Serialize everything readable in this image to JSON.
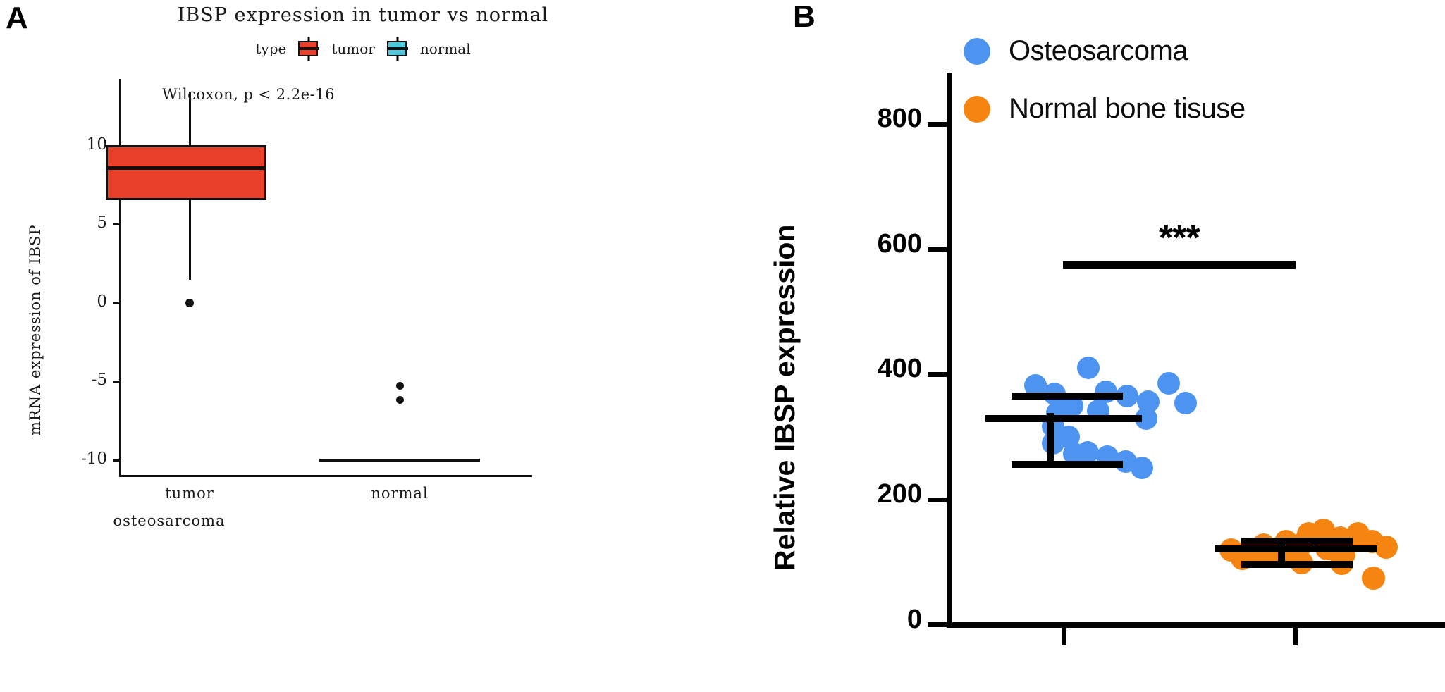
{
  "figure": {
    "panels": [
      {
        "letter": "A"
      },
      {
        "letter": "B"
      }
    ]
  },
  "panel_a": {
    "letter": "A",
    "title": "IBSP expression in tumor vs normal",
    "legend_title": "type",
    "legend_items": [
      {
        "label": "tumor",
        "color": "#E8402A"
      },
      {
        "label": "normal",
        "color": "#4DC8DD"
      }
    ],
    "annotation": "Wilcoxon, p < 2.2e-16",
    "y_axis_title": "mRNA expression of IBSP",
    "x_axis_title": "osteosarcoma",
    "y_ticks": [
      "10",
      "5",
      "0",
      "-5",
      "-10"
    ],
    "x_categories": [
      "tumor",
      "normal"
    ]
  },
  "panel_b": {
    "letter": "B",
    "y_axis_title": "Relative IBSP expression",
    "y_ticks": [
      "800",
      "600",
      "400",
      "200",
      "0"
    ],
    "legend_items": [
      {
        "label": "Osteosarcoma",
        "color": "#4D94F0"
      },
      {
        "label": "Normal bone tisuse",
        "color": "#F58410"
      }
    ],
    "significance": "***"
  },
  "chart_data": [
    {
      "type": "box",
      "panel": "A",
      "title": "IBSP expression in tumor vs normal",
      "xlabel": "osteosarcoma",
      "ylabel": "mRNA expression of IBSP",
      "ylim": [
        -11.6,
        13.6
      ],
      "ytick_values": [
        10,
        5,
        0,
        -5,
        -10
      ],
      "grid": false,
      "legend": {
        "title": "type",
        "position": "top",
        "entries": [
          "tumor",
          "normal"
        ]
      },
      "annotations": [
        {
          "text": "Wilcoxon, p < 2.2e-16",
          "x": "tumor",
          "y": 12.2
        }
      ],
      "categories": [
        "tumor",
        "normal"
      ],
      "series": [
        {
          "name": "tumor",
          "color": "#E8402A",
          "q1": 6.6,
          "median": 8.5,
          "q3": 10.05,
          "whisker_low": 1.45,
          "whisker_high": 13.45,
          "outliers": [
            0.3
          ]
        },
        {
          "name": "normal",
          "color": "#4DC8DD",
          "q1": -10.0,
          "median": -10.0,
          "q3": -10.0,
          "whisker_low": -10.0,
          "whisker_high": -10.0,
          "outliers": [
            -5.0,
            -5.45
          ]
        }
      ]
    },
    {
      "type": "scatter",
      "panel": "B",
      "title": "",
      "xlabel": "",
      "ylabel": "Relative IBSP expression",
      "ylim": [
        0,
        900
      ],
      "ytick_values": [
        0,
        200,
        400,
        600,
        800
      ],
      "grid": false,
      "legend": {
        "position": "top",
        "entries": [
          "Osteosarcoma",
          "Normal bone tisuse"
        ]
      },
      "annotations": [
        {
          "text": "***",
          "between": [
            "Osteosarcoma",
            "Normal bone tisuse"
          ],
          "y": 620
        }
      ],
      "categories": [
        "Osteosarcoma",
        "Normal bone tisuse"
      ],
      "series": [
        {
          "name": "Osteosarcoma",
          "color": "#4D94F0",
          "mean": 355,
          "sd_upper": 393,
          "sd_lower": 318,
          "values": [
            387,
            372,
            414,
            378,
            389,
            357,
            363,
            360,
            355,
            352,
            347,
            338,
            330,
            325,
            318,
            312,
            305,
            296,
            291,
            358
          ],
          "n": 20
        },
        {
          "name": "Normal bone tisuse",
          "color": "#F58410",
          "mean": 120,
          "sd_upper": 133,
          "sd_lower": 107,
          "values": [
            116,
            114,
            113,
            112,
            111,
            131,
            126,
            152,
            143,
            139,
            135,
            130,
            125,
            122,
            118,
            110,
            104,
            100,
            86,
            137
          ],
          "n": 20
        }
      ]
    }
  ]
}
